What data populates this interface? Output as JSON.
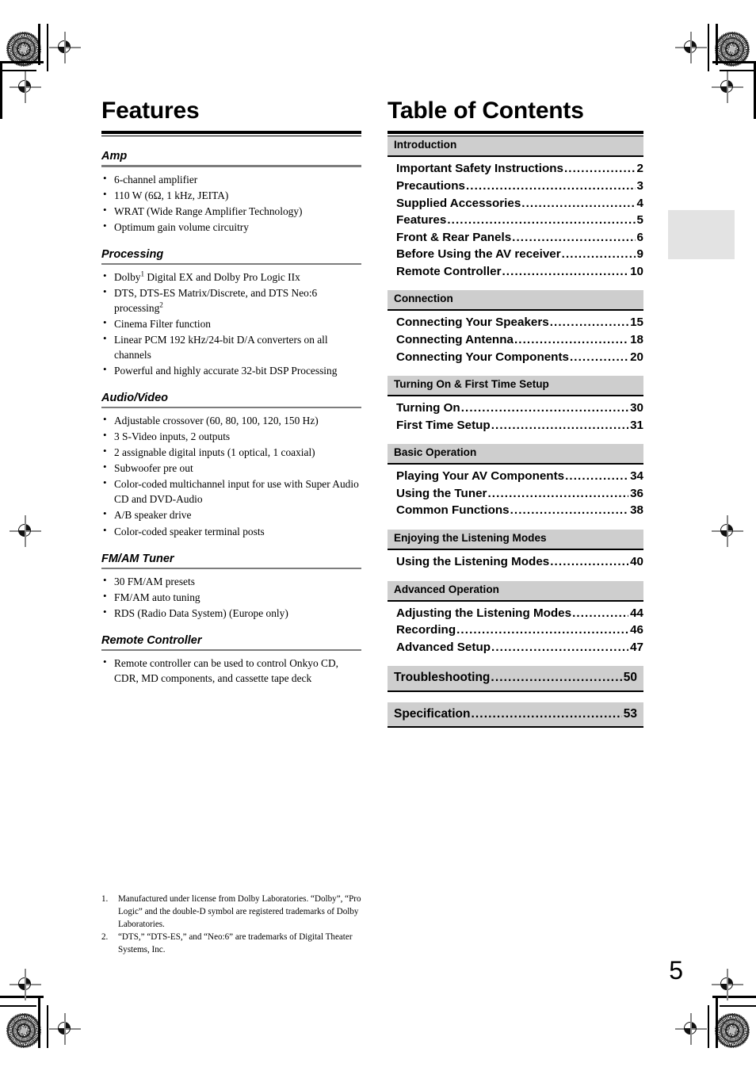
{
  "document": {
    "page_number": "5"
  },
  "left_column": {
    "title": "Features",
    "sections": [
      {
        "heading": "Amp",
        "items": [
          "6-channel amplifier",
          "110 W (6Ω, 1 kHz, JEITA)",
          "WRAT (Wide Range Amplifier Technology)",
          "Optimum gain volume circuitry"
        ]
      },
      {
        "heading": "Processing",
        "items": [
          "Dolby<sup>1</sup> Digital EX and Dolby Pro Logic IIx",
          "DTS, DTS-ES Matrix/Discrete, and DTS Neo:6 processing<sup>2</sup>",
          "Cinema Filter function",
          "Linear PCM 192 kHz/24-bit D/A converters on all channels",
          "Powerful and highly accurate 32-bit DSP Processing"
        ]
      },
      {
        "heading": "Audio/Video",
        "items": [
          "Adjustable crossover (60, 80, 100, 120, 150 Hz)",
          "3 S-Video inputs, 2 outputs",
          "2 assignable digital inputs (1 optical, 1 coaxial)",
          "Subwoofer pre out",
          "Color-coded multichannel input for use with Super Audio CD and DVD-Audio",
          "A/B speaker drive",
          "Color-coded speaker terminal posts"
        ]
      },
      {
        "heading": "FM/AM Tuner",
        "items": [
          "30 FM/AM presets",
          "FM/AM auto tuning",
          "RDS (Radio Data System) (Europe only)"
        ]
      },
      {
        "heading": "Remote Controller",
        "items": [
          "Remote controller can be used to control Onkyo CD, CDR, MD components, and cassette tape deck"
        ]
      }
    ],
    "footnotes": [
      {
        "number": "1.",
        "text": "Manufactured under license from Dolby Laboratories. “Dolby”, “Pro Logic” and the double-D symbol are registered trademarks of Dolby Laboratories."
      },
      {
        "number": "2.",
        "text": "“DTS,” “DTS-ES,” and “Neo:6” are trademarks of Digital Theater Systems, Inc."
      }
    ]
  },
  "right_column": {
    "title": "Table of Contents",
    "groups": [
      {
        "band_label": "Introduction",
        "standalone": false,
        "entries": [
          {
            "label": "Important Safety Instructions",
            "page": "2"
          },
          {
            "label": "Precautions",
            "page": "3"
          },
          {
            "label": "Supplied Accessories",
            "page": "4"
          },
          {
            "label": "Features",
            "page": "5"
          },
          {
            "label": "Front & Rear Panels",
            "page": "6"
          },
          {
            "label": "Before Using the AV receiver",
            "page": "9"
          },
          {
            "label": "Remote Controller",
            "page": "10"
          }
        ]
      },
      {
        "band_label": "Connection",
        "standalone": false,
        "entries": [
          {
            "label": "Connecting Your Speakers",
            "page": "15"
          },
          {
            "label": "Connecting Antenna",
            "page": "18"
          },
          {
            "label": "Connecting Your Components",
            "page": "20"
          }
        ]
      },
      {
        "band_label": "Turning On & First Time Setup",
        "standalone": false,
        "entries": [
          {
            "label": "Turning On",
            "page": "30"
          },
          {
            "label": "First Time Setup",
            "page": "31"
          }
        ]
      },
      {
        "band_label": "Basic Operation",
        "standalone": false,
        "entries": [
          {
            "label": "Playing Your AV Components",
            "page": "34"
          },
          {
            "label": "Using the Tuner",
            "page": "36"
          },
          {
            "label": "Common Functions",
            "page": "38"
          }
        ]
      },
      {
        "band_label": "Enjoying the Listening Modes",
        "standalone": false,
        "entries": [
          {
            "label": "Using the Listening Modes",
            "page": "40"
          }
        ]
      },
      {
        "band_label": "Advanced Operation",
        "standalone": false,
        "entries": [
          {
            "label": "Adjusting the Listening Modes",
            "page": "44"
          },
          {
            "label": "Recording",
            "page": "46"
          },
          {
            "label": "Advanced Setup",
            "page": "47"
          }
        ]
      },
      {
        "band_label": "Troubleshooting",
        "standalone": true,
        "page": "50",
        "entries": []
      },
      {
        "band_label": "Specification",
        "standalone": true,
        "page": "53",
        "entries": []
      }
    ]
  },
  "colors": {
    "band_background": "#cecece",
    "side_tab": "#e3e3e3",
    "sub_rule": "#7d7d7d",
    "text": "#000000"
  }
}
